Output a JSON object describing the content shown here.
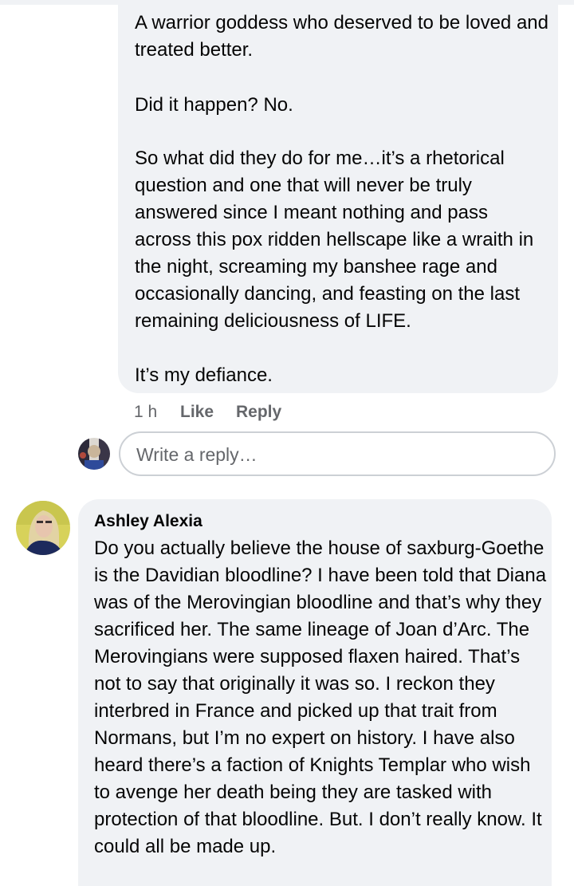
{
  "first_comment": {
    "paragraphs": [
      "A warrior goddess who deserved to be loved and treated better.",
      "Did it happen? No.",
      "So what did they do for me…it’s a rhetorical question and one that will never be truly answered since I meant nothing and pass across this pox ridden hellscape like a wraith in the night, screaming my banshee rage and occasionally dancing, and feasting on the last remaining deliciousness of LIFE.",
      "It’s my defiance."
    ],
    "timestamp": "1 h",
    "like_label": "Like",
    "reply_label": "Reply"
  },
  "reply_box": {
    "placeholder": "Write a reply…"
  },
  "second_comment": {
    "author": "Ashley Alexia",
    "text": "Do you actually believe the house of saxburg-Goethe is the Davidian bloodline? I have been told that Diana was of the Merovingian bloodline and that’s why they sacrificed her. The same lineage of Joan d’Arc. The Merovingians were supposed flaxen haired. That’s not to say that originally it was so. I reckon they interbred in France and picked up that trait from Normans, but I’m no expert on history. I have also heard there’s a faction of Knights Templar who wish to avenge her death being they are tasked with protection of that bloodline. But. I don’t really know. It could all be made up."
  },
  "colors": {
    "bubble_bg": "#f0f2f5",
    "secondary_text": "#65676b",
    "primary_text": "#050505",
    "input_border": "#ccd0d5"
  }
}
